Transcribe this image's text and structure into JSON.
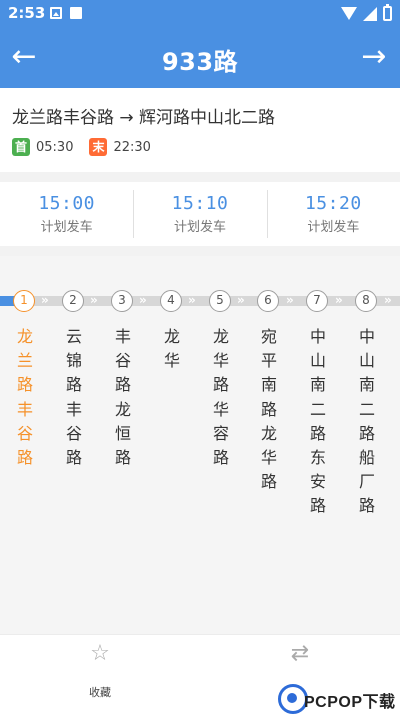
{
  "status_bar": {
    "time": "2:53"
  },
  "header": {
    "title": "933路",
    "back_icon": "arrow-left-icon",
    "forward_icon": "arrow-right-icon"
  },
  "route": {
    "name": "龙兰路丰谷路 → 辉河路中山北二路",
    "first_label": "首",
    "first_time": "05:30",
    "last_label": "末",
    "last_time": "22:30"
  },
  "schedule": [
    {
      "time": "15:00",
      "label": "计划发车"
    },
    {
      "time": "15:10",
      "label": "计划发车"
    },
    {
      "time": "15:20",
      "label": "计划发车"
    }
  ],
  "stops": [
    {
      "num": "1",
      "name": "龙兰路丰谷路",
      "current": true
    },
    {
      "num": "2",
      "name": "云锦路丰谷路",
      "current": false
    },
    {
      "num": "3",
      "name": "丰谷路龙恒路",
      "current": false
    },
    {
      "num": "4",
      "name": "龙华",
      "current": false
    },
    {
      "num": "5",
      "name": "龙华路华容路",
      "current": false
    },
    {
      "num": "6",
      "name": "宛平南路龙华路",
      "current": false
    },
    {
      "num": "7",
      "name": "中山南二路东安路",
      "current": false
    },
    {
      "num": "8",
      "name": "中山南二路船厂路",
      "current": false
    }
  ],
  "bottom_bar": {
    "favorite_label": "收藏",
    "favorite_icon": "star-icon",
    "switch_icon": "swap-icon"
  },
  "watermark": {
    "text": "PCPOP下载"
  },
  "colors": {
    "primary": "#4a90e2",
    "current_stop": "#f5912a",
    "first_badge": "#4caf50",
    "last_badge": "#ff6b35"
  }
}
